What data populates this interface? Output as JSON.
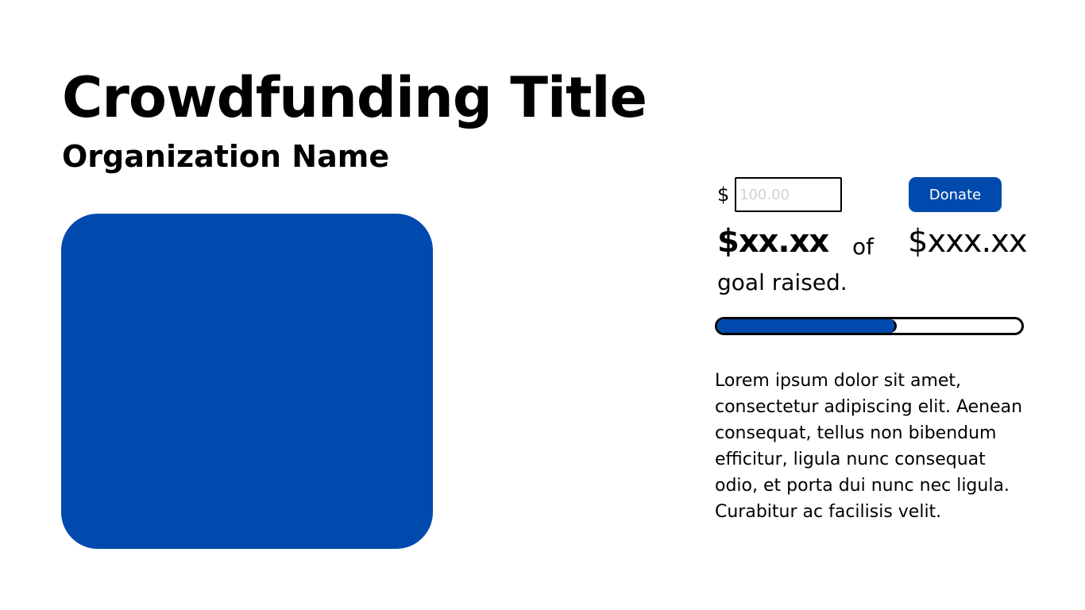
{
  "campaign": {
    "title": "Crowdfunding Title",
    "organization": "Organization Name"
  },
  "colors": {
    "accent": "#004aad",
    "text": "#000000",
    "background": "#ffffff"
  },
  "donation": {
    "currency_symbol": "$",
    "amount_placeholder": "100.00",
    "amount_value": "",
    "donate_label": "Donate"
  },
  "progress": {
    "raised": "$xx.xx",
    "of_label": "of",
    "goal": "$xxx.xx",
    "caption": "goal raised.",
    "fraction": 0.59
  },
  "description": "Lorem ipsum dolor sit amet, consectetur adipiscing elit. Aenean consequat, tellus non bibendum efficitur, ligula nunc consequat odio, et porta dui nunc nec ligula. Curabitur ac facilisis velit."
}
